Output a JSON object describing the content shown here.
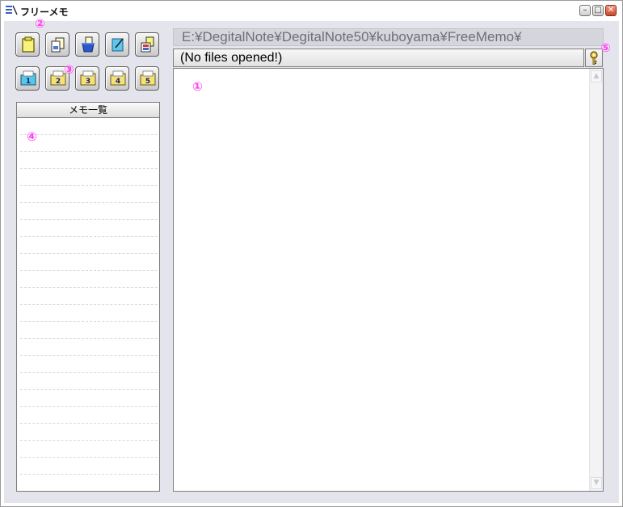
{
  "window": {
    "title": "フリーメモ",
    "minimize_glyph": "–",
    "maximize_glyph": "□",
    "close_glyph": "✕"
  },
  "toolbar": {
    "row1": [
      "new-memo-icon",
      "open-memo-icon",
      "delete-memo-icon",
      "edit-memo-icon",
      "save-memo-icon"
    ],
    "row2": [
      {
        "icon": "folder-1-icon",
        "label": "1"
      },
      {
        "icon": "folder-2-icon",
        "label": "2"
      },
      {
        "icon": "folder-3-icon",
        "label": "3"
      },
      {
        "icon": "folder-4-icon",
        "label": "4"
      },
      {
        "icon": "folder-5-icon",
        "label": "5"
      }
    ]
  },
  "markers": {
    "m1": "①",
    "m2": "②",
    "m3": "③",
    "m4": "④",
    "m5": "⑤"
  },
  "memo_list": {
    "header": "メモ一覧",
    "items": []
  },
  "path_bar": {
    "path": "E:¥DegitalNote¥DegitalNote50¥kuboyama¥FreeMemo¥"
  },
  "status_bar": {
    "text": "(No files opened!)"
  },
  "editor": {
    "content": ""
  },
  "colors": {
    "marker": "#ff3ef1",
    "client_bg": "#e4e4ec",
    "folder_active": "#55c8e6",
    "folder_inactive": "#f3e27a"
  }
}
